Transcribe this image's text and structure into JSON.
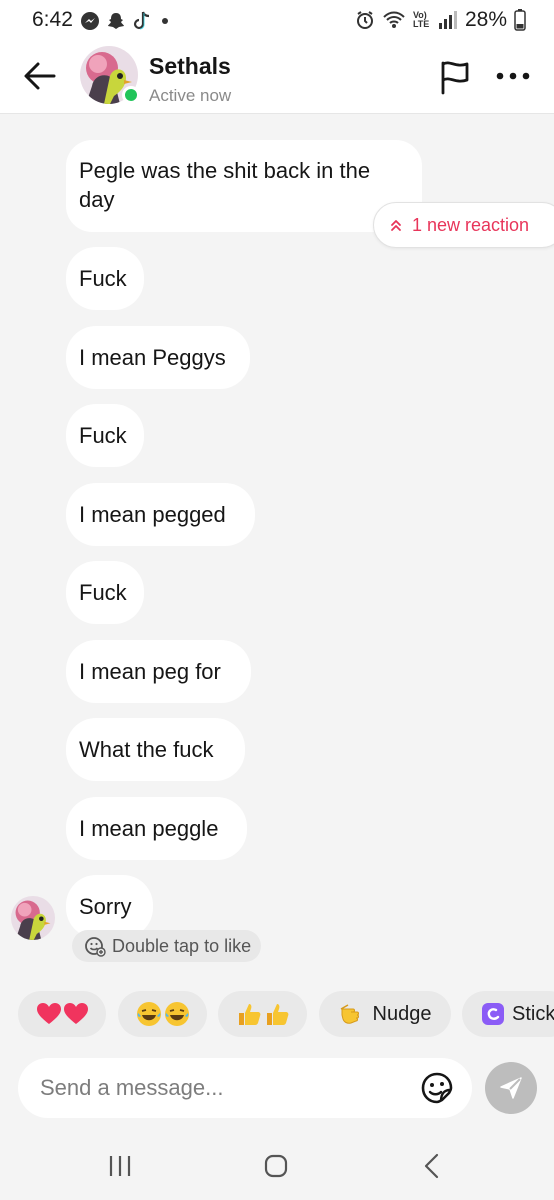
{
  "status_bar": {
    "time": "6:42",
    "network_label": "Vo) LTE",
    "battery": "28%"
  },
  "header": {
    "contact_name": "Sethals",
    "contact_status": "Active now",
    "icons": [
      "back-arrow-icon",
      "flag-icon",
      "more-icon"
    ]
  },
  "messages": [
    {
      "text": "Pegle was the shit back in the day"
    },
    {
      "text": "Fuck"
    },
    {
      "text": "I mean Peggys"
    },
    {
      "text": "Fuck"
    },
    {
      "text": "I mean pegged"
    },
    {
      "text": "Fuck"
    },
    {
      "text": "I mean peg for"
    },
    {
      "text": "What the fuck"
    },
    {
      "text": "I mean peggle"
    },
    {
      "text": "Sorry"
    }
  ],
  "new_reaction": {
    "label": "1 new reaction",
    "color": "#e8355a"
  },
  "double_tap_hint": "Double tap to like",
  "quick_reactions": [
    {
      "label": "",
      "emoji": "❤️❤️"
    },
    {
      "label": "",
      "emoji": "😂😂"
    },
    {
      "label": "",
      "emoji": "👍👍"
    },
    {
      "label": "Nudge",
      "emoji": "👈"
    },
    {
      "label": "Stick",
      "emoji": ""
    }
  ],
  "composer": {
    "placeholder": "Send a message..."
  },
  "colors": {
    "online": "#21c45a",
    "accent": "#e8355a",
    "sticker_purple": "#8b5cf6"
  }
}
